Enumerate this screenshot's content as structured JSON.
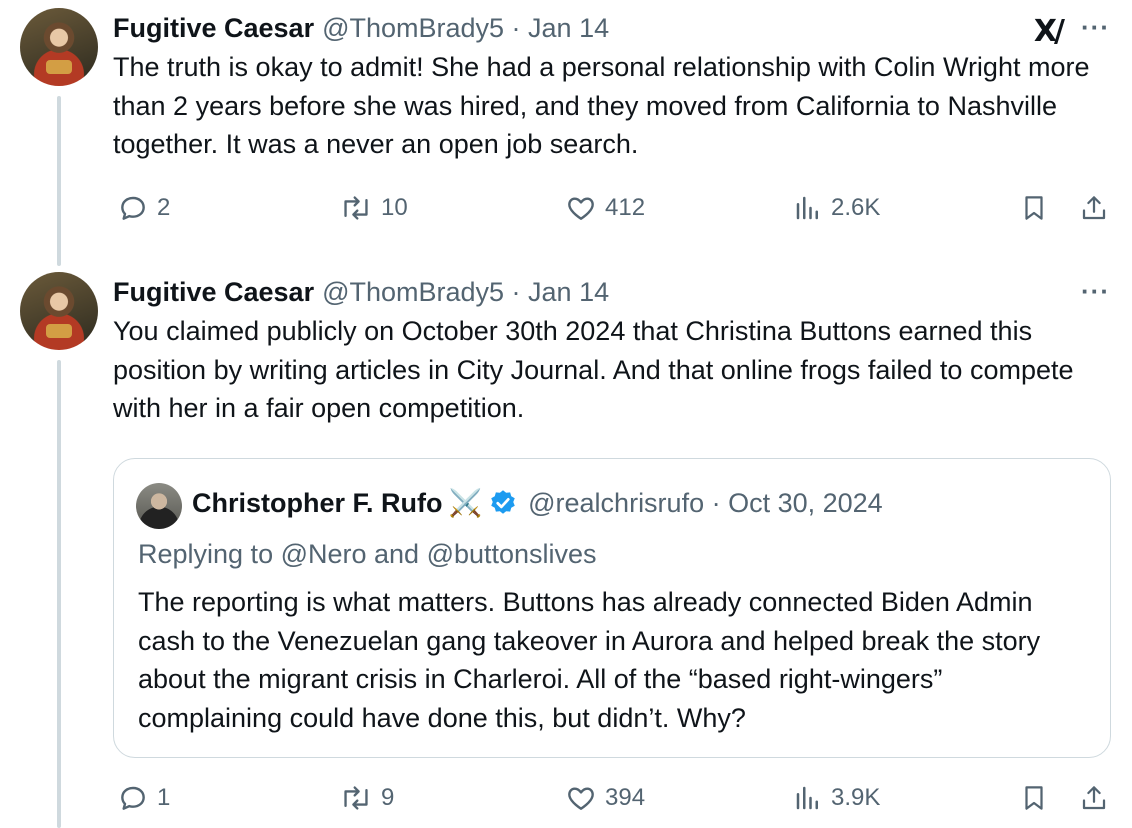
{
  "tweets": [
    {
      "name": "Fugitive Caesar",
      "handle": "@ThomBrady5 · Jan 14",
      "grok_icon": "grok-logo-icon",
      "text": "The truth is okay to admit! She had a personal relationship with Colin Wright more than 2 years before she was hired, and they moved from California to Nashville together. It was a never an open job search.",
      "replies": "2",
      "reposts": "10",
      "likes": "412",
      "views": "2.6K"
    },
    {
      "name": "Fugitive Caesar",
      "handle": "@ThomBrady5 · Jan 14",
      "text": "You claimed publicly on October 30th 2024 that Christina Buttons earned this position by writing articles in City Journal. And that online frogs failed to compete with her in a fair open competition.",
      "replies": "1",
      "reposts": "9",
      "likes": "394",
      "views": "3.9K"
    }
  ],
  "quote": {
    "name": "Christopher F. Rufo",
    "emoji": "⚔️",
    "handle": "@realchrisrufo · Oct 30, 2024",
    "replying_to": "Replying to @Nero and @buttonslives",
    "text": "The reporting is what matters. Buttons has already connected Biden Admin cash to the Venezuelan gang takeover in Aurora and helped break the story about the migrant crisis in Charleroi. All of the “based right-wingers” complaining could have done this, but didn’t. Why?"
  },
  "menu_label": "···",
  "colors": {
    "text": "#0f1419",
    "secondary": "#536471",
    "border": "#cfd9de",
    "verified": "#1d9bf0"
  }
}
